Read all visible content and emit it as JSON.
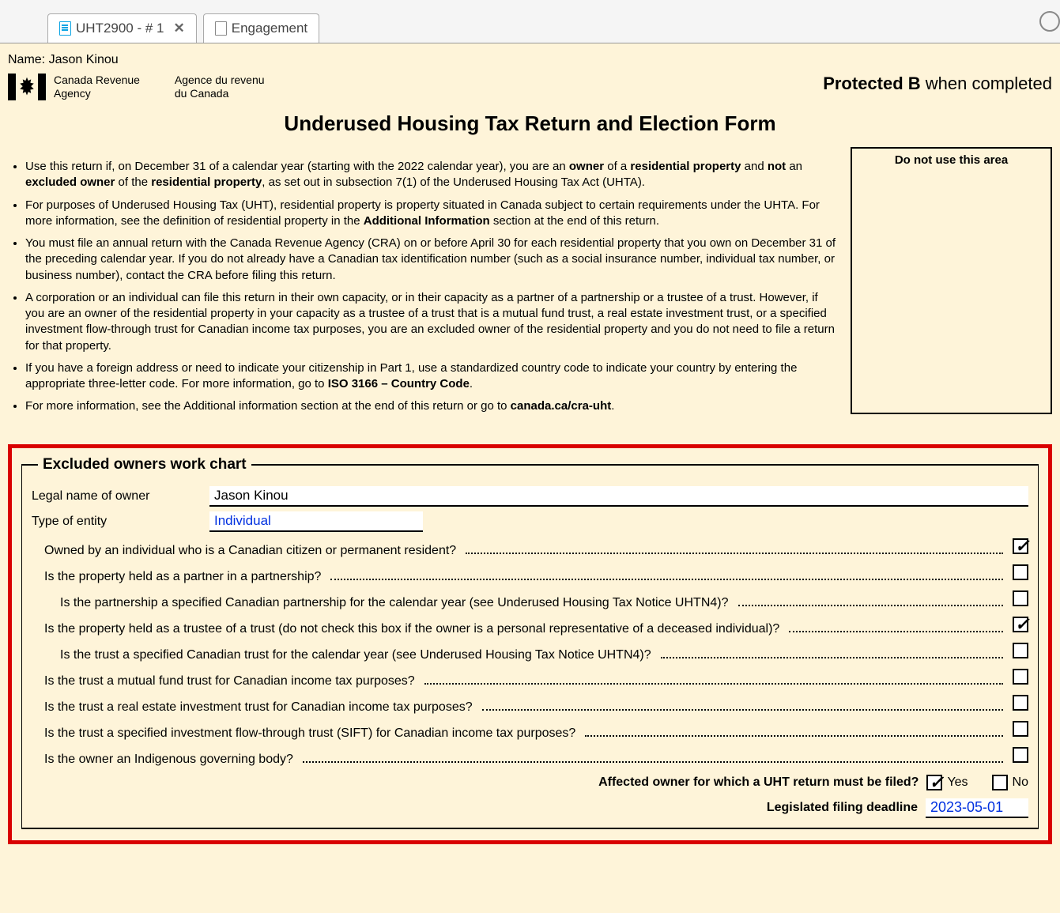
{
  "tabs": [
    {
      "label": "UHT2900 - # 1",
      "active": true
    },
    {
      "label": "Engagement",
      "active": false
    }
  ],
  "name_label": "Name:",
  "name_value": "Jason Kinou",
  "agency_en_line1": "Canada Revenue",
  "agency_en_line2": "Agency",
  "agency_fr_line1": "Agence du revenu",
  "agency_fr_line2": "du Canada",
  "protected_bold": "Protected B",
  "protected_rest": " when completed",
  "form_title": "Underused Housing Tax Return and Election Form",
  "bullet1_a": "Use this return if, on December 31 of a calendar year (starting with the 2022 calendar year), you are an ",
  "bullet1_b": "owner",
  "bullet1_c": " of a ",
  "bullet1_d": "residential property",
  "bullet1_e": " and ",
  "bullet1_f": "not",
  "bullet1_g": " an ",
  "bullet1_h": "excluded owner",
  "bullet1_i": " of the ",
  "bullet1_j": "residential property",
  "bullet1_k": ", as set out in subsection 7(1) of the Underused Housing Tax Act (UHTA).",
  "bullet2_a": "For purposes of Underused Housing Tax (UHT), residential property is property situated in Canada subject to certain requirements under the UHTA. For more information, see the definition of residential property in the ",
  "bullet2_b": "Additional Information",
  "bullet2_c": " section at the end of this return.",
  "bullet3": "You must file an annual return with the Canada Revenue Agency (CRA) on or before April 30 for each residential property that you own on December 31 of the preceding calendar year. If you do not already have a Canadian tax identification number (such as a social insurance number, individual tax number, or business number), contact the CRA before filing this return.",
  "bullet4": "A corporation or an individual can file this return in their own capacity, or in their capacity as a partner of a partnership or a trustee of a trust. However, if you are an owner of the residential property in your capacity as a trustee of a trust that is a mutual fund trust, a real estate investment trust, or a specified investment flow-through trust for Canadian income tax purposes, you are an excluded owner of the residential property and you do not need to file a return for that property.",
  "bullet5_a": "If you have a foreign address or need to indicate your citizenship in Part 1, use a standardized country code to indicate your country by entering the appropriate three-letter code. For more information, go to ",
  "bullet5_b": "ISO 3166 – Country Code",
  "bullet5_c": ".",
  "bullet6_a": "For more information, see the Additional information section at the end of this return or go to ",
  "bullet6_b": "canada.ca/cra-uht",
  "bullet6_c": ".",
  "nouse_label": "Do not use this area",
  "workchart_legend": "Excluded owners work chart",
  "legal_name_label": "Legal name of owner",
  "legal_name_value": "Jason Kinou",
  "entity_label": "Type of entity",
  "entity_value": "Individual",
  "questions": [
    {
      "text": "Owned by an individual who is a Canadian citizen or permanent resident?",
      "indent": 1,
      "checked": true
    },
    {
      "text": "Is the property held as a partner in a partnership?",
      "indent": 1,
      "checked": false
    },
    {
      "text": "Is the partnership a specified Canadian partnership for the calendar year (see Underused Housing Tax Notice UHTN4)?",
      "indent": 2,
      "checked": false
    },
    {
      "text": "Is the property held as a trustee of a trust (do not check this box if the owner is a personal representative of a deceased individual)?",
      "indent": 1,
      "checked": true
    },
    {
      "text": "Is the trust a specified Canadian trust for the calendar year (see Underused Housing Tax Notice UHTN4)?",
      "indent": 2,
      "checked": false
    },
    {
      "text": "Is the trust a mutual fund trust for Canadian income tax purposes?",
      "indent": 1,
      "checked": false
    },
    {
      "text": "Is the trust a real estate investment trust for Canadian income tax purposes?",
      "indent": 1,
      "checked": false
    },
    {
      "text": "Is the trust a specified investment flow-through trust (SIFT) for Canadian income tax purposes?",
      "indent": 1,
      "checked": false
    },
    {
      "text": "Is the owner an Indigenous governing body?",
      "indent": 1,
      "checked": false
    }
  ],
  "affected_label": "Affected owner for which a UHT return must be filed?",
  "yes_label": "Yes",
  "no_label": "No",
  "affected_yes_checked": true,
  "affected_no_checked": false,
  "deadline_label": "Legislated filing deadline",
  "deadline_value": "2023-05-01"
}
